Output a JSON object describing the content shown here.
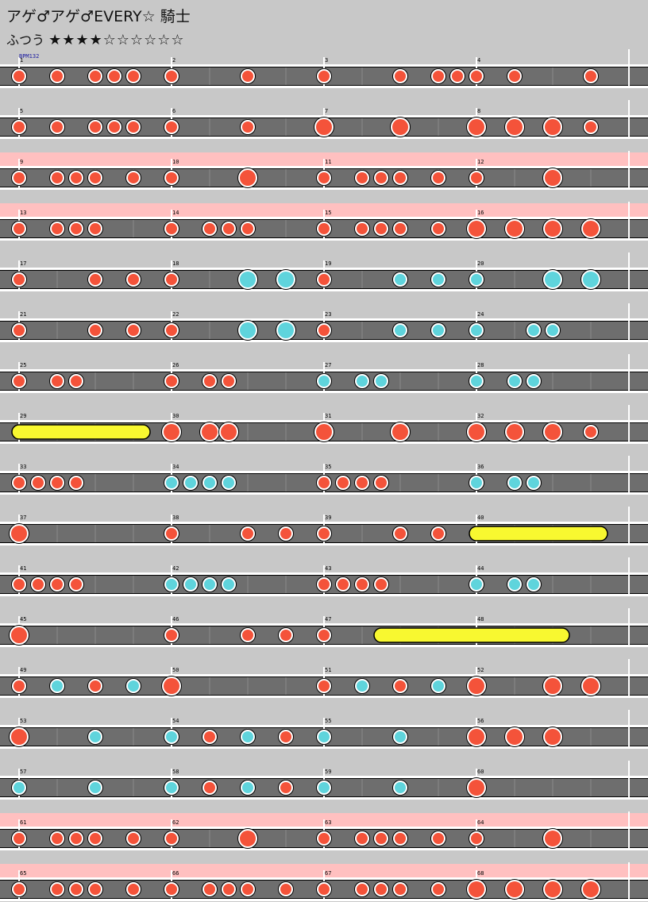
{
  "header": {
    "title": "アゲ♂アゲ♂EVERY☆ 騎士",
    "difficulty_label": "ふつう",
    "stars_filled": "★★★★",
    "stars_empty": "☆☆☆☆☆☆"
  },
  "bpm_label": "BPM132",
  "colors": {
    "background": "#c8c8c8",
    "lane": "#6e6e6e",
    "gogo_band": "#ffc0c0",
    "don": "#f4533a",
    "ka": "#5fd4dc",
    "roll": "#f8f830"
  },
  "notes_legend": {
    "d": "don (small)",
    "D": "don (big)",
    "k": "ka (small)",
    "K": "ka (big)",
    "roll": "drumroll (yellow bar)"
  },
  "rows": [
    {
      "measures": [
        1,
        2,
        3,
        4
      ],
      "gogo": false,
      "notes": "d.d.ddd.d...d...d...d.ddd.d...d.....d...",
      "rolls": []
    },
    {
      "measures": [
        5,
        6,
        7,
        8
      ],
      "gogo": false,
      "notes": "d.d.ddd.d...d...D...D...D.D.D.d.........",
      "rolls": []
    },
    {
      "measures": [
        9,
        10,
        11,
        12
      ],
      "gogo": true,
      "notes": "d.ddd.d.d...D...d.ddd.d.d...D.........",
      "rolls": []
    },
    {
      "measures": [
        13,
        14,
        15,
        16
      ],
      "gogo": true,
      "notes": "d.ddd...d.ddd...d.ddd.d.D.D.D.D.......",
      "rolls": []
    },
    {
      "measures": [
        17,
        18,
        19,
        20
      ],
      "gogo": false,
      "notes": "d...d.d.d...K.K.d...k.k.k...K.K.......",
      "rolls": []
    },
    {
      "measures": [
        21,
        22,
        23,
        24
      ],
      "gogo": false,
      "notes": "d...d.d.d...K.K.d...k.k.k..kk.........",
      "rolls": []
    },
    {
      "measures": [
        25,
        26,
        27,
        28
      ],
      "gogo": false,
      "notes": "d.dd....d.dd....k.kk....k.kk..........",
      "rolls": []
    },
    {
      "measures": [
        29,
        30,
        31,
        32
      ],
      "gogo": false,
      "notes": "........D.DD....D...D...D.D.D.d.......",
      "rolls": [
        {
          "start": 0,
          "end": 6.5
        }
      ]
    },
    {
      "measures": [
        33,
        34,
        35,
        36
      ],
      "gogo": false,
      "notes": "dddd....kkkk....dddd....k.kk..........",
      "rolls": []
    },
    {
      "measures": [
        37,
        38,
        39,
        40
      ],
      "gogo": false,
      "notes": "D.......d...d.d.d...d.d.........",
      "rolls": [
        {
          "start": 24,
          "end": 30.5
        }
      ]
    },
    {
      "measures": [
        41,
        42,
        43,
        44
      ],
      "gogo": false,
      "notes": "dddd....kkkk....dddd....k.kk..........",
      "rolls": []
    },
    {
      "measures": [
        45,
        46,
        47,
        48
      ],
      "gogo": false,
      "notes": "D.......d...d.d.d.......",
      "rolls": [
        {
          "start": 19,
          "end": 28.5
        }
      ]
    },
    {
      "measures": [
        49,
        50,
        51,
        52
      ],
      "gogo": false,
      "notes": "d.k.d.k.D.......d.k.d.k.D...D.D.......",
      "rolls": []
    },
    {
      "measures": [
        53,
        54,
        55,
        56
      ],
      "gogo": false,
      "notes": "D...k...k.d.k.d.k...k...D.D.D.........",
      "rolls": []
    },
    {
      "measures": [
        57,
        58,
        59,
        60
      ],
      "gogo": false,
      "notes": "k...k...k.d.k.d.k...k...D.............",
      "rolls": []
    },
    {
      "measures": [
        61,
        62,
        63,
        64
      ],
      "gogo": true,
      "notes": "d.ddd.d.d...D...d.ddd.d.d...D.........",
      "rolls": []
    },
    {
      "measures": [
        65,
        66,
        67,
        68
      ],
      "gogo": true,
      "notes": "d.ddd.d.d.ddd.d.d.ddd.d.D.D.D.D.......",
      "rolls": []
    }
  ]
}
